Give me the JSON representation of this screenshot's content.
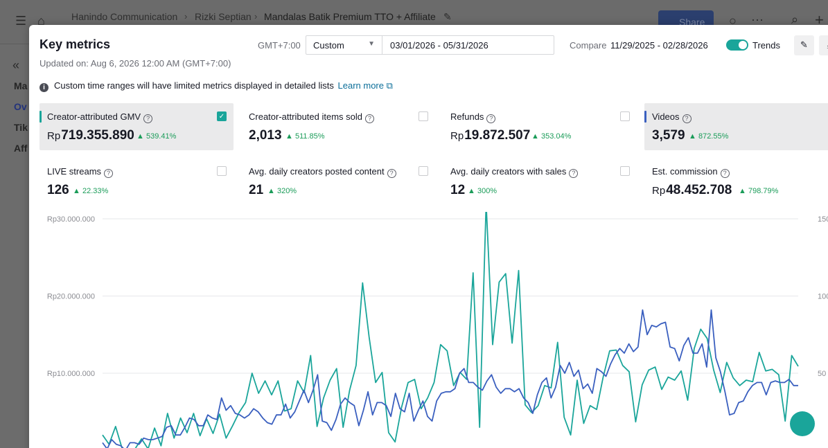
{
  "background": {
    "breadcrumbs": [
      "Hanindo Communication",
      "Rizki Septian",
      "Mandalas Batik Premium TTO + Affiliate"
    ],
    "share_label": "Share",
    "sidebar": [
      "Ma",
      "Ov",
      "Tik",
      "Aff"
    ]
  },
  "modal": {
    "title": "Key metrics",
    "updated": "Updated on: Aug 6, 2026 12:00 AM (GMT+7:00)",
    "timezone": "GMT+7:00",
    "range_type": "Custom",
    "date_range": "03/01/2026 - 05/31/2026",
    "compare_label": "Compare",
    "compare_range": "11/29/2025 - 02/28/2026",
    "trends_label": "Trends",
    "trends_on": true,
    "notice": "Custom time ranges will have limited metrics displayed in detailed lists",
    "learn_more": "Learn more"
  },
  "metrics": [
    {
      "label": "Creator-attributed GMV",
      "currency": "Rp",
      "value": "719.355.890",
      "change": "539.41%",
      "checked": true,
      "color": "#1aa59a"
    },
    {
      "label": "Creator-attributed items sold",
      "currency": "",
      "value": "2,013",
      "change": "511.85%",
      "checked": false
    },
    {
      "label": "Refunds",
      "currency": "Rp",
      "value": "19.872.507",
      "change": "353.04%",
      "checked": false
    },
    {
      "label": "Videos",
      "currency": "",
      "value": "3,579",
      "change": "872.55%",
      "checked": true,
      "color": "#3a5fbf"
    },
    {
      "label": "LIVE streams",
      "currency": "",
      "value": "126",
      "change": "22.33%",
      "checked": false
    },
    {
      "label": "Avg. daily creators posted content",
      "currency": "",
      "value": "21",
      "change": "320%",
      "checked": false
    },
    {
      "label": "Avg. daily creators with sales",
      "currency": "",
      "value": "12",
      "change": "300%",
      "checked": false
    },
    {
      "label": "Est. commission",
      "currency": "Rp",
      "value": "48.452.708",
      "change": "798.79%",
      "checked": false
    }
  ],
  "chart_data": {
    "type": "line",
    "y_left_ticks": [
      "Rp30.000.000",
      "Rp20.000.000",
      "Rp10.000.000"
    ],
    "y_right_ticks": [
      "150",
      "100",
      "50"
    ],
    "ylim_left": [
      0,
      30000000
    ],
    "ylim_right": [
      0,
      150
    ],
    "grid": true,
    "series": [
      {
        "color": "#1aa59a",
        "axis": "left",
        "values": [
          2000000,
          800000,
          3100000,
          300000,
          0,
          200000,
          1500000,
          200000,
          2900000,
          600000,
          4800000,
          1600000,
          4200000,
          2300000,
          4800000,
          1900000,
          4100000,
          2200000,
          4700000,
          1600000,
          3200000,
          4900000,
          6200000,
          10000000,
          7400000,
          9000000,
          7200000,
          9000000,
          5100000,
          5400000,
          9000000,
          7500000,
          12300000,
          3100000,
          6800000,
          9100000,
          10600000,
          3000000,
          7800000,
          11000000,
          21700000,
          14700000,
          8800000,
          10100000,
          2300000,
          1100000,
          5600000,
          8800000,
          9200000,
          5400000,
          6800000,
          8800000,
          13700000,
          12900000,
          8400000,
          10100000,
          9200000,
          23000000,
          3000000,
          32000000,
          13700000,
          21800000,
          22900000,
          13900000,
          23300000,
          5900000,
          4900000,
          5800000,
          8400000,
          8100000,
          14000000,
          4300000,
          2000000,
          9100000,
          3500000,
          5800000,
          5300000,
          9500000,
          12900000,
          13000000,
          11000000,
          10200000,
          3700000,
          8500000,
          10400000,
          10800000,
          7900000,
          9500000,
          9100000,
          10300000,
          6500000,
          13200000,
          15700000,
          14500000,
          10400000,
          7500000,
          11400000,
          9400000,
          8400000,
          9100000,
          8900000,
          12700000,
          10300000,
          10500000,
          9800000,
          3800000,
          12300000,
          10900000
        ],
        "note": "values approximated from plotted line"
      },
      {
        "color": "#3a5fbf",
        "axis": "right",
        "values": [
          5,
          1,
          7,
          4,
          3,
          0,
          5,
          5,
          4,
          8,
          7,
          7,
          8,
          9,
          15,
          16,
          10,
          10,
          15,
          21,
          20,
          16,
          16,
          23,
          21,
          20,
          34,
          26,
          29,
          24,
          23,
          21,
          23,
          27,
          25,
          21,
          18,
          17,
          23,
          23,
          30,
          21,
          25,
          32,
          39,
          31,
          39,
          49,
          19,
          18,
          13,
          20,
          30,
          34,
          31,
          29,
          16,
          26,
          38,
          23,
          31,
          31,
          29,
          22,
          37,
          27,
          25,
          37,
          19,
          26,
          32,
          22,
          19,
          32,
          37,
          38,
          38,
          40,
          50,
          53,
          44,
          44,
          41,
          39,
          45,
          49,
          41,
          37,
          40,
          40,
          38,
          40,
          34,
          31,
          24,
          36,
          44,
          47,
          34,
          41,
          55,
          50,
          57,
          48,
          52,
          40,
          43,
          37,
          53,
          51,
          48,
          56,
          62,
          66,
          63,
          69,
          64,
          67,
          91,
          75,
          81,
          80,
          82,
          83,
          67,
          66,
          58,
          68,
          73,
          63,
          63,
          69,
          54,
          91,
          60,
          51,
          38,
          23,
          24,
          31,
          32,
          38,
          42,
          44,
          44,
          36,
          44,
          45,
          44,
          44,
          46,
          42,
          42
        ]
      }
    ]
  }
}
